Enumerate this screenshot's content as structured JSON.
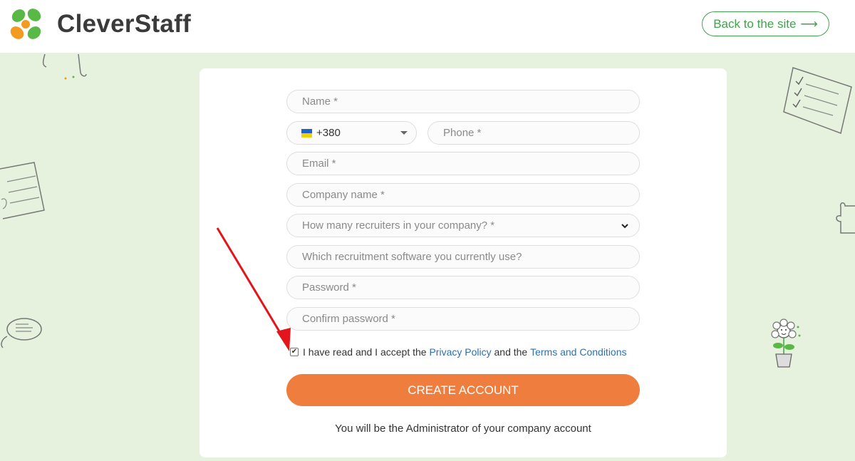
{
  "brand": {
    "name": "CleverStaff"
  },
  "header": {
    "back_label": "Back to the site",
    "back_arrow": "⟶"
  },
  "form": {
    "name_placeholder": "Name *",
    "phone_code": "+380",
    "phone_placeholder": "Phone *",
    "email_placeholder": "Email *",
    "company_placeholder": "Company name *",
    "recruiters_placeholder": "How many recruiters in your company? *",
    "software_placeholder": "Which recruitment software you currently use?",
    "password_placeholder": "Password *",
    "confirm_placeholder": "Confirm password *",
    "consent_prefix": "I have read and I accept the",
    "privacy_link": "Privacy Policy",
    "consent_middle": "and the",
    "terms_link": "Terms and Conditions",
    "consent_checked": true,
    "create_label": "CREATE ACCOUNT",
    "admin_note": "You will be the Administrator of your company account"
  },
  "colors": {
    "brand_green": "#3fa34a",
    "accent_orange": "#ee7d3e",
    "page_bg": "#e6f2dd",
    "link_blue": "#2f6fb0",
    "arrow_red": "#e3141b"
  }
}
